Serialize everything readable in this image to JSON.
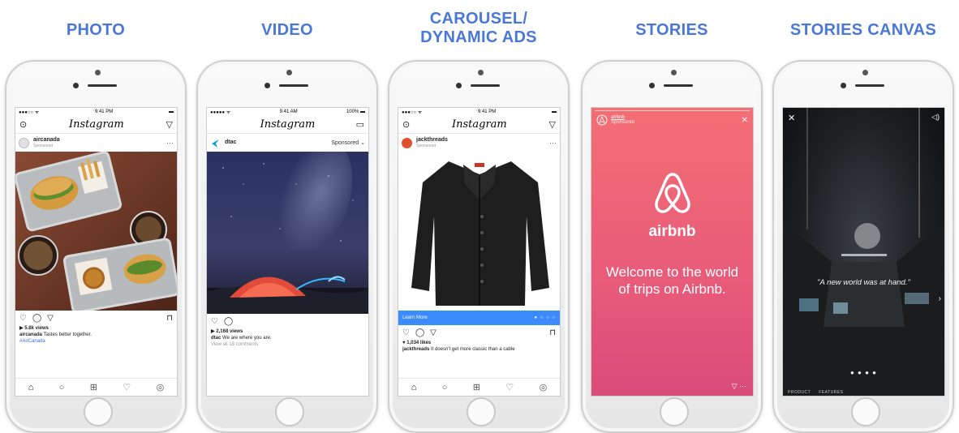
{
  "columns": [
    {
      "title_lines": [
        "PHOTO"
      ],
      "status": {
        "left": "●●●○○ ᯤ",
        "center": "9:41 PM",
        "right": "▬"
      },
      "ig_logo": "Instagram",
      "post": {
        "user": "aircanada",
        "sub": "Sponsored",
        "more": "···"
      },
      "views": "▶ 5.8k views",
      "caption_user": "aircanada",
      "caption": "Tastes better together.",
      "hashtag": "#AirCanada"
    },
    {
      "title_lines": [
        "VIDEO"
      ],
      "status": {
        "left": "●●●●● ᯤ",
        "center": "9:41 AM",
        "right": "100% ▬"
      },
      "ig_logo": "Instagram",
      "post": {
        "user": "dtac",
        "sponsored": "Sponsored ⌄"
      },
      "views": "▶ 2,168 views",
      "caption_user": "dtac",
      "caption": "We are where you are.",
      "comments": "View all 18 comments"
    },
    {
      "title_lines": [
        "CAROUSEL/",
        "DYNAMIC ADS"
      ],
      "status": {
        "left": "●●●○○ ᯤ",
        "center": "9:41 PM",
        "right": "▬"
      },
      "ig_logo": "Instagram",
      "post": {
        "user": "jackthreads",
        "sub": "Sponsored",
        "more": "···"
      },
      "cta": "Learn More",
      "cta_pager": "● ○ ○ ○",
      "likes": "♥ 1,034 likes",
      "caption_user": "jackthreads",
      "caption": "It doesn't get more classic than a cable"
    },
    {
      "title_lines": [
        "STORIES"
      ],
      "story": {
        "user": "airbnb",
        "sub": "Sponsored",
        "brand": "airbnb",
        "message": "Welcome to the world of trips on Airbnb."
      }
    },
    {
      "title_lines": [
        "STORIES CANVAS"
      ],
      "canvas": {
        "quote": "\"A new world was at hand.\"",
        "dots": "● ● ● ●",
        "labels": [
          "PRODUCT",
          "FEATURES"
        ]
      }
    }
  ],
  "icons": {
    "camera": "⊙",
    "direct": "▽",
    "inbox": "▭",
    "like": "♡",
    "comment": "◯",
    "share": "▽",
    "save": "⊓",
    "home": "⌂",
    "search": "○",
    "add": "⊞",
    "heart": "♡",
    "profile": "◎",
    "close": "✕",
    "volume": "◁)",
    "next": "›"
  },
  "colors": {
    "title": "#4a78d8",
    "cta": "#3b8bff",
    "story": "#e85b7a"
  }
}
